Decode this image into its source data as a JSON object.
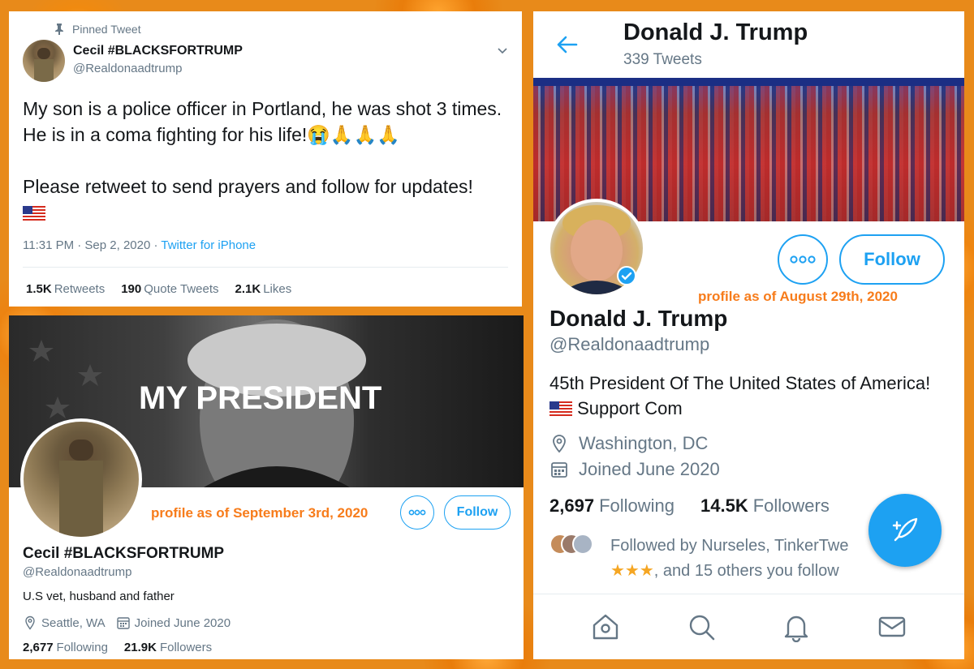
{
  "tweet": {
    "pinned_label": "Pinned Tweet",
    "author_name": "Cecil #BLACKSFORTRUMP",
    "author_handle": "@Realdonaadtrump",
    "text_line1": "My son is a police officer in Portland, he was shot 3 times. He is in a coma fighting for his life!😭🙏🙏🙏",
    "text_line2": "Please retweet to send prayers and follow for updates!",
    "timestamp": "11:31 PM · Sep 2, 2020 · ",
    "source": "Twitter for iPhone",
    "retweets_count": "1.5K",
    "retweets_label": "Retweets",
    "quotes_count": "190",
    "quotes_label": "Quote Tweets",
    "likes_count": "2.1K",
    "likes_label": "Likes"
  },
  "cecil_profile": {
    "banner_text": "MY PRESIDENT",
    "note": "profile as of September 3rd, 2020",
    "follow_label": "Follow",
    "name": "Cecil #BLACKSFORTRUMP",
    "handle": "@Realdonaadtrump",
    "bio": "U.S vet, husband and father",
    "location": "Seattle, WA",
    "joined": "Joined June 2020",
    "following_count": "2,677",
    "following_label": "Following",
    "followers_count": "21.9K",
    "followers_label": "Followers"
  },
  "trump_profile": {
    "header_title": "Donald J. Trump",
    "tweet_count": "339 Tweets",
    "note": "profile as of August 29th, 2020",
    "follow_label": "Follow",
    "name": "Donald J. Trump",
    "handle": "@Realdonaadtrump",
    "bio_part1": "45th President Of The United States of America!",
    "bio_part2": " Support Com",
    "location": "Washington, DC",
    "joined": "Joined June 2020",
    "following_count": "2,697",
    "following_label": "Following",
    "followers_count": "14.5K",
    "followers_label": "Followers",
    "followed_by_text": "Followed by Nurseles, TinkerTwe",
    "followed_by_stars": "★★★",
    "followed_by_rest": ", and 15 others you follow"
  },
  "colors": {
    "accent": "#1da1f2",
    "note": "#f77c1b",
    "text": "#14171a",
    "muted": "#657786"
  }
}
